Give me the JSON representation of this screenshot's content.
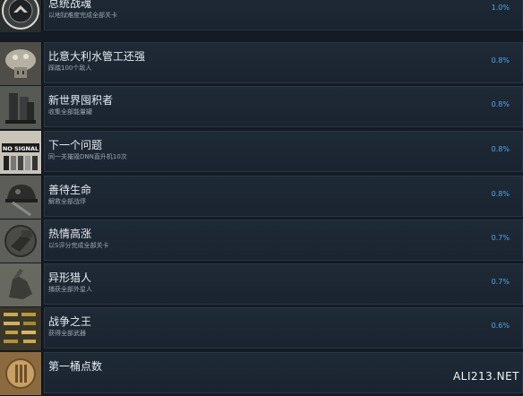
{
  "achievements": [
    {
      "title": "总统战魂",
      "desc": "以地狱难度完成全部关卡",
      "percent": "1.0%",
      "icon": "president-seal-icon"
    },
    {
      "title": "比意大利水管工还强",
      "desc": "踩踏100个敌人",
      "percent": "0.8%",
      "icon": "mushroom-icon"
    },
    {
      "title": "新世界囤积者",
      "desc": "收集全部能量罐",
      "percent": "0.8%",
      "icon": "canisters-icon"
    },
    {
      "title": "下一个问题",
      "desc": "同一关摧毁DNN直升机10次",
      "percent": "0.8%",
      "icon": "no-signal-icon"
    },
    {
      "title": "善待生命",
      "desc": "解救全部战俘",
      "percent": "0.8%",
      "icon": "helmet-icon"
    },
    {
      "title": "热情高涨",
      "desc": "以S评分完成全部关卡",
      "percent": "0.7%",
      "icon": "fist-icon"
    },
    {
      "title": "异形猎人",
      "desc": "捕获全部外星人",
      "percent": "0.7%",
      "icon": "alien-hand-icon"
    },
    {
      "title": "战争之王",
      "desc": "获得全部武器",
      "percent": "0.6%",
      "icon": "weapons-rack-icon"
    },
    {
      "title": "第一桶点数",
      "desc": "",
      "percent": "",
      "icon": "medal-icon"
    }
  ],
  "watermark": "ALI213.NET"
}
